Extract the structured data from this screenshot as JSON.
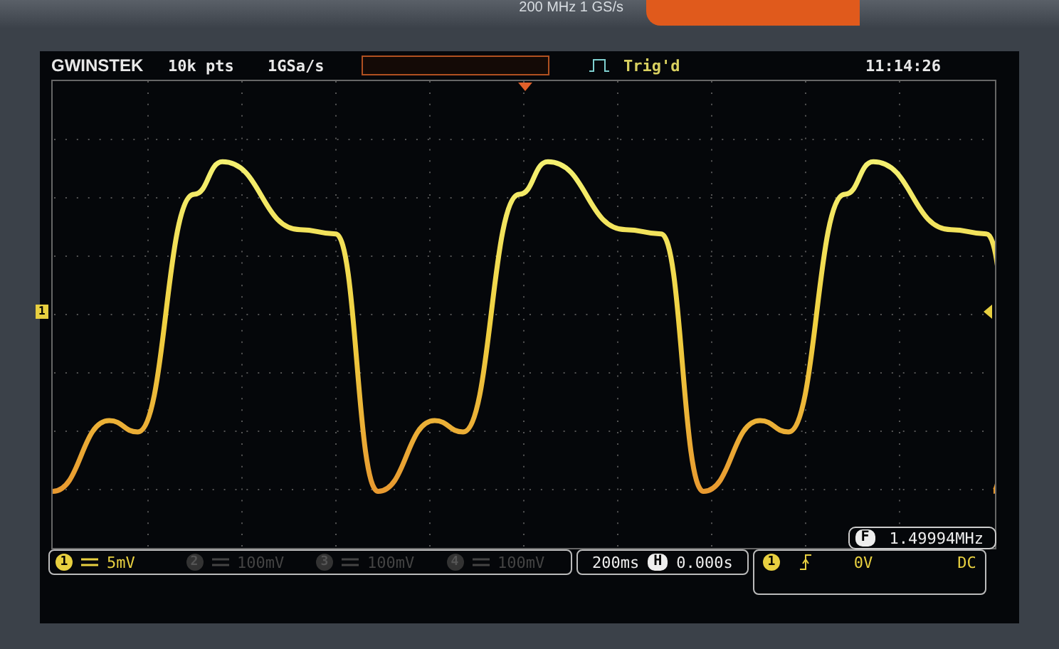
{
  "bezel": {
    "specs": "200 MHz   1 GS/s"
  },
  "header": {
    "logo": "GWINSTEK",
    "record_length": "10k pts",
    "sample_rate": "1GSa/s",
    "trigger_status": "Trig'd",
    "time": "11:14:26"
  },
  "ch1_marker": "1",
  "frequency": {
    "label": "F",
    "value": "1.49994MHz"
  },
  "channels": [
    {
      "number": "1",
      "scale": "5mV",
      "on": true
    },
    {
      "number": "2",
      "scale": "100mV",
      "on": false
    },
    {
      "number": "3",
      "scale": "100mV",
      "on": false
    },
    {
      "number": "4",
      "scale": "100mV",
      "on": false
    }
  ],
  "timebase": {
    "scale": "200ms",
    "position_label": "H",
    "position": "0.000s"
  },
  "trigger": {
    "source": "1",
    "level": "0V",
    "coupling": "DC"
  }
}
